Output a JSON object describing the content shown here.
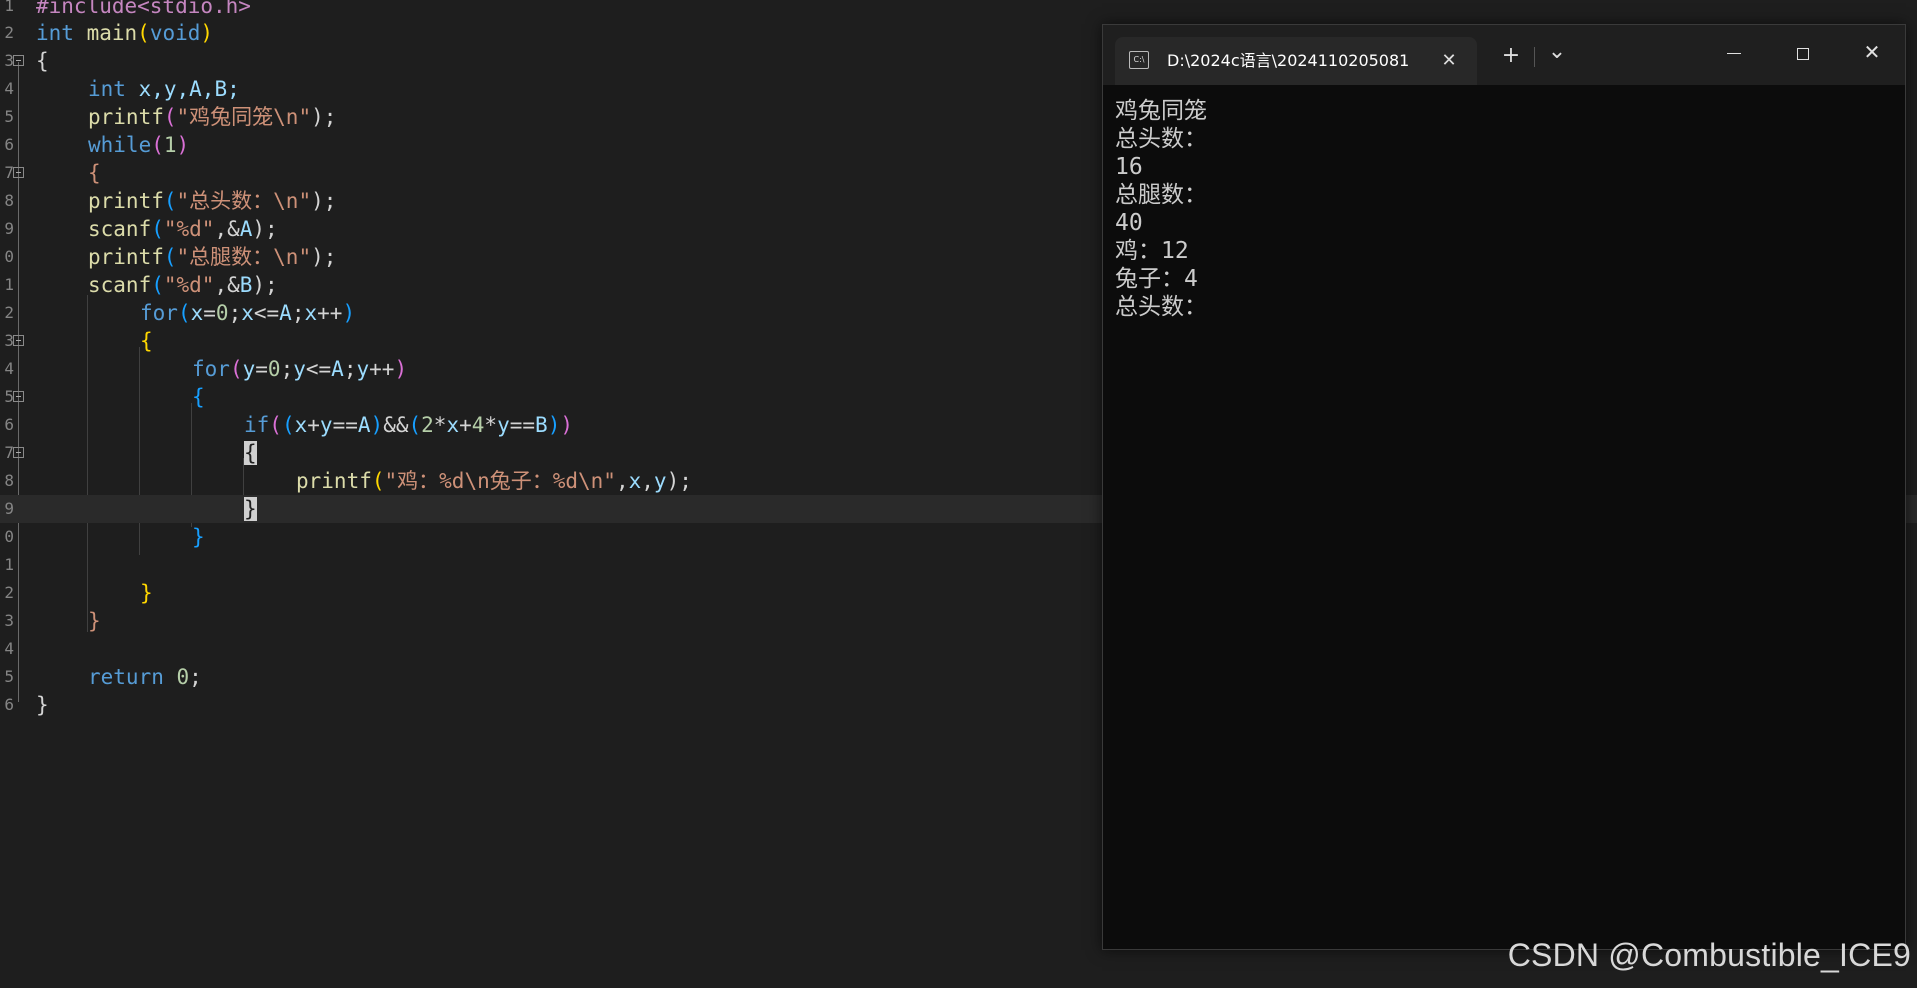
{
  "editor": {
    "line_numbers": [
      "1",
      "2",
      "3",
      "4",
      "5",
      "6",
      "7",
      "8",
      "9",
      "0",
      "1",
      "2",
      "3",
      "4",
      "5",
      "6",
      "7",
      "8",
      "9",
      "0",
      "1",
      "2",
      "3",
      "4",
      "5",
      "6"
    ],
    "code": {
      "l1_pp": "#include<stdio.h>",
      "l2_int": "int",
      "l2_main": "main",
      "l2_paren_open": "(",
      "l2_void": "void",
      "l2_paren_close": ")",
      "l3_brace": "{",
      "l4_int": "int",
      "l4_rest": " x,y,A,B;",
      "l5_fn": "printf",
      "l5_open": "(",
      "l5_str": "\"鸡兔同笼\\n\"",
      "l5_close": ");",
      "l6_while": "while",
      "l6_open": "(",
      "l6_num": "1",
      "l6_close": ")",
      "l7_brace": "{",
      "l8_fn": "printf",
      "l8_open": "(",
      "l8_str": "\"总头数：\\n\"",
      "l8_close": ");",
      "l9_fn": "scanf",
      "l9_open": "(",
      "l9_str": "\"%d\"",
      "l9_comma": ",&",
      "l9_var": "A",
      "l9_close": ");",
      "l10_fn": "printf",
      "l10_open": "(",
      "l10_str": "\"总腿数：\\n\"",
      "l10_close": ");",
      "l11_fn": "scanf",
      "l11_open": "(",
      "l11_str": "\"%d\"",
      "l11_comma": ",&",
      "l11_var": "B",
      "l11_close": ");",
      "l12_for": "for",
      "l12_open": "(",
      "l12_x1": "x",
      "l12_eq": "=",
      "l12_zero": "0",
      "l12_semi": ";",
      "l12_x2": "x",
      "l12_le": "<=",
      "l12_A": "A",
      "l12_semi2": ";",
      "l12_x3": "x",
      "l12_inc": "++",
      "l12_close": ")",
      "l13_brace": "{",
      "l14_for": "for",
      "l14_open": "(",
      "l14_y1": "y",
      "l14_eq": "=",
      "l14_zero": "0",
      "l14_semi": ";",
      "l14_y2": "y",
      "l14_le": "<=",
      "l14_A": "A",
      "l14_semi2": ";",
      "l14_y3": "y",
      "l14_inc": "++",
      "l14_close": ")",
      "l15_brace": "{",
      "l16_if": "if",
      "l16_open1": "(",
      "l16_open2": "(",
      "l16_x": "x",
      "l16_plus": "+",
      "l16_y": "y",
      "l16_eqeq": "==",
      "l16_A": "A",
      "l16_close2": ")",
      "l16_and": "&&",
      "l16_open3": "(",
      "l16_two": "2",
      "l16_mul1": "*",
      "l16_x2": "x",
      "l16_plus2": "+",
      "l16_four": "4",
      "l16_mul2": "*",
      "l16_y2": "y",
      "l16_eqeq2": "==",
      "l16_B": "B",
      "l16_close3": ")",
      "l16_close1": ")",
      "l17_brace": "{",
      "l18_fn": "printf",
      "l18_open": "(",
      "l18_str": "\"鸡：%d\\n兔子：%d\\n\"",
      "l18_comma": ",",
      "l18_x": "x",
      "l18_comma2": ",",
      "l18_y": "y",
      "l18_close": ");",
      "l19_brace": "}",
      "l20_brace": "}",
      "l22_brace": "}",
      "l23_brace": "}",
      "l25_return": "return",
      "l25_zero": "0",
      "l25_semi": ";",
      "l26_brace": "}"
    }
  },
  "terminal": {
    "tab_title": "D:\\2024c语言\\2024110205081",
    "tab_icon_text": "C:\\",
    "tab_close": "✕",
    "new_tab": "+",
    "dropdown": "⌄",
    "close": "✕",
    "output_lines": [
      "鸡兔同笼",
      "总头数：",
      "16",
      "总腿数：",
      "40",
      "鸡：12",
      "兔子：4",
      "总头数："
    ]
  },
  "watermark": "CSDN @Combustible_ICE9"
}
